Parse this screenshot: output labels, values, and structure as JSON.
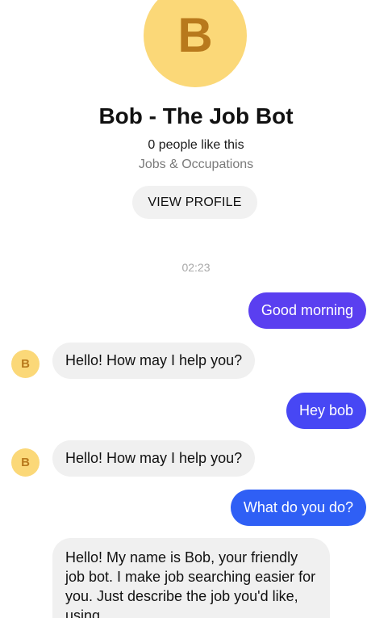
{
  "profile": {
    "avatar_letter": "B",
    "name": "Bob - The Job Bot",
    "likes": "0 people like this",
    "category": "Jobs & Occupations",
    "view_profile_label": "VIEW PROFILE"
  },
  "chat": {
    "timestamp": "02:23",
    "bot_avatar_letter": "B",
    "messages": [
      {
        "sender": "user",
        "text": "Good morning"
      },
      {
        "sender": "bot",
        "text": "Hello! How may I help you?"
      },
      {
        "sender": "user",
        "text": "Hey bob"
      },
      {
        "sender": "bot",
        "text": "Hello! How may I help you?"
      },
      {
        "sender": "user",
        "text": "What do you do?"
      },
      {
        "sender": "bot",
        "text": "Hello! My name is Bob, your friendly job bot. I make job searching easier for you. Just describe the job you'd like, using"
      }
    ]
  },
  "colors": {
    "avatar_bg": "#fbd878",
    "avatar_letter": "#b8791c",
    "outgoing_1": "#5a3ff0",
    "outgoing_2": "#4747f4",
    "outgoing_3": "#2f5ff5",
    "incoming_bg": "#f0f0f0"
  }
}
